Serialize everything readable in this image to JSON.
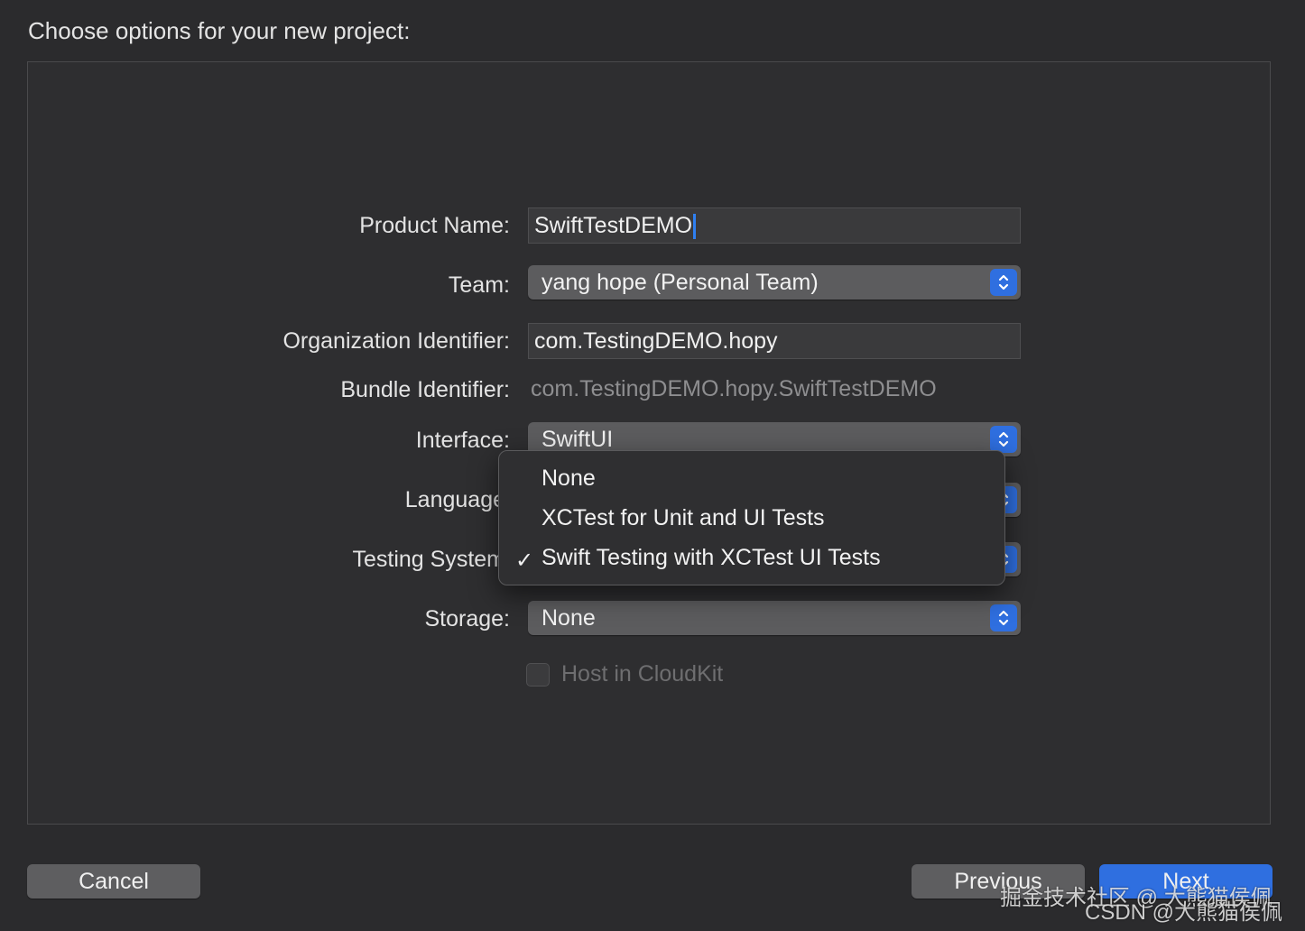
{
  "header": {
    "title": "Choose options for your new project:"
  },
  "form": {
    "product_name": {
      "label": "Product Name:",
      "value": "SwiftTestDEMO"
    },
    "team": {
      "label": "Team:",
      "value": "yang hope (Personal Team)"
    },
    "org_identifier": {
      "label": "Organization Identifier:",
      "value": "com.TestingDEMO.hopy"
    },
    "bundle_identifier": {
      "label": "Bundle Identifier:",
      "value": "com.TestingDEMO.hopy.SwiftTestDEMO"
    },
    "interface": {
      "label": "Interface:",
      "value": "SwiftUI"
    },
    "language": {
      "label": "Language"
    },
    "testing_system": {
      "label": "Testing System"
    },
    "storage": {
      "label": "Storage:",
      "value": "None"
    },
    "host_in_cloudkit": {
      "label": "Host in CloudKit",
      "checked": false,
      "enabled": false
    }
  },
  "testing_menu": {
    "items": [
      {
        "label": "None",
        "selected": false
      },
      {
        "label": "XCTest for Unit and UI Tests",
        "selected": false
      },
      {
        "label": "Swift Testing with XCTest UI Tests",
        "selected": true
      }
    ],
    "checkmark": "✓"
  },
  "footer": {
    "cancel_label": "Cancel",
    "previous_label": "Previous",
    "next_label": "Next"
  },
  "watermark": {
    "line1": "掘金技术社区 @ 大熊猫侯佩",
    "line2": "CSDN @大熊猫侯佩"
  },
  "colors": {
    "accent": "#2f6fe0",
    "background": "#2b2b2d",
    "control": "#5c5c5e"
  },
  "icons": {
    "stepper": "updown-chevron-icon",
    "checkmark": "checkmark-icon"
  }
}
